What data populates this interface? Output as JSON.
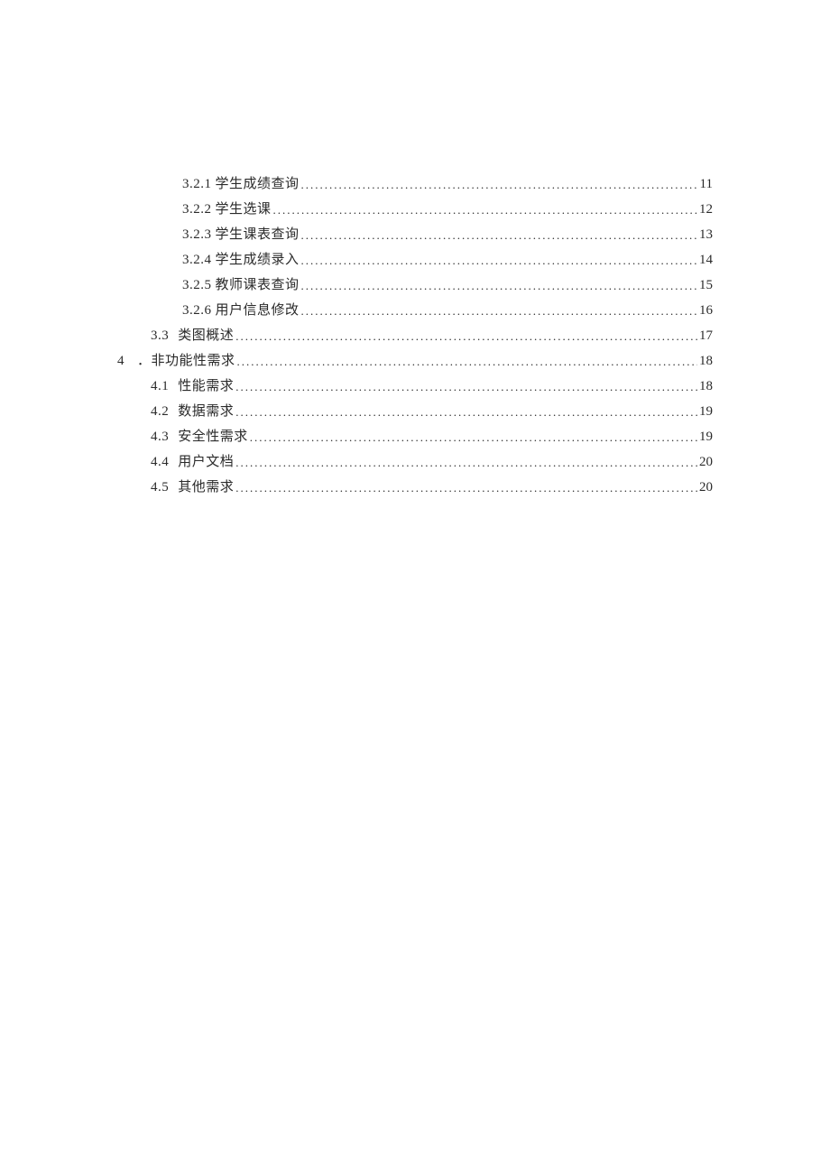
{
  "toc": [
    {
      "level": 3,
      "num": "3.2.1",
      "title": "学生成绩查询",
      "page": "11"
    },
    {
      "level": 3,
      "num": "3.2.2",
      "title": "学生选课",
      "page": "12"
    },
    {
      "level": 3,
      "num": "3.2.3",
      "title": "学生课表查询",
      "page": "13"
    },
    {
      "level": 3,
      "num": "3.2.4",
      "title": "学生成绩录入",
      "page": "14"
    },
    {
      "level": 3,
      "num": "3.2.5",
      "title": "教师课表查询",
      "page": "15"
    },
    {
      "level": 3,
      "num": "3.2.6",
      "title": "用户信息修改",
      "page": "16"
    },
    {
      "level": 2,
      "num": "3.3",
      "title": "类图概述",
      "page": "17"
    },
    {
      "level": 1,
      "num": "4",
      "title": "．非功能性需求",
      "page": "18"
    },
    {
      "level": 2,
      "num": "4.1",
      "title": "性能需求",
      "page": "18"
    },
    {
      "level": 2,
      "num": "4.2",
      "title": "数据需求",
      "page": "19"
    },
    {
      "level": 2,
      "num": "4.3",
      "title": "安全性需求",
      "page": "19"
    },
    {
      "level": 2,
      "num": "4.4",
      "title": "用户文档",
      "page": "20"
    },
    {
      "level": 2,
      "num": "4.5",
      "title": "其他需求",
      "page": "20"
    }
  ]
}
